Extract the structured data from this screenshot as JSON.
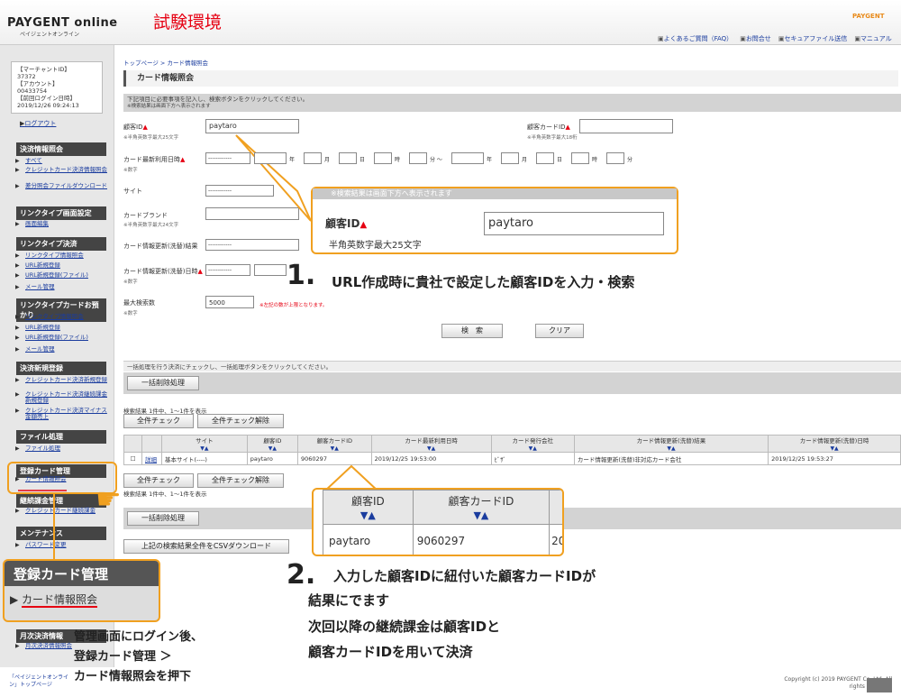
{
  "header": {
    "logo": "PAYGENT online",
    "logo_sub": "ペイジェントオンライン",
    "env_title": "試験環境",
    "brand": "PAYGENT",
    "links": [
      "よくあるご質問（FAQ）",
      "お問合せ",
      "セキュアファイル送信",
      "マニュアル"
    ]
  },
  "sidebar": {
    "merchant_box": [
      "【マーチャントID】",
      "37372",
      "【アカウント】",
      "00433754",
      "【前回ログイン日時】",
      "2019/12/26 09:24:13"
    ],
    "logout": "ログアウト",
    "sections": [
      {
        "title": "決済情報照会",
        "items": [
          "すべて",
          "クレジットカード決済情報照会",
          "差分照会ファイルダウンロード"
        ]
      },
      {
        "title": "リンクタイプ画面設定",
        "items": [
          "画面編集"
        ]
      },
      {
        "title": "リンクタイプ決済",
        "items": [
          "リンクタイプ情報照会",
          "URL新規登録",
          "URL新規登録(ファイル)",
          "メール管理"
        ]
      },
      {
        "title": "リンクタイプカードお預かり",
        "items": [
          "リンクタイプ情報照会",
          "URL新規登録",
          "URL新規登録(ファイル)",
          "メール管理"
        ]
      },
      {
        "title": "決済新規登録",
        "items": [
          "クレジットカード決済新規登録",
          "クレジットカード決済継続課金新規登録",
          "クレジットカード決済マイナス金額売上"
        ]
      },
      {
        "title": "ファイル処理",
        "items": [
          "ファイル処理"
        ]
      },
      {
        "title": "登録カード管理",
        "items": [
          "カード情報照会"
        ]
      },
      {
        "title": "継続課金管理",
        "items": [
          "クレジットカード継続課金"
        ]
      },
      {
        "title": "メンテナンス",
        "items": [
          "パスワード変更"
        ]
      },
      {
        "title": "月次決済情報",
        "items": [
          "月次決済情報照会"
        ]
      }
    ],
    "footer": "「ペイジェントオンライン」トップページ"
  },
  "main": {
    "breadcrumb": "トップページ > カード情報照会",
    "title": "カード情報照会",
    "instructions": "下記項目に必要事項を記入し、検索ボタンをクリックしてください。",
    "instructions2": "※検索結果は画面下方へ表示されます",
    "fields": {
      "customer_id_label": "顧客ID",
      "customer_id_value": "paytaro",
      "customer_id_note": "※半角英数字最大25文字",
      "customer_card_id_label": "顧客カードID",
      "customer_card_id_note": "※半角英数字最大18桁",
      "last_used_label": "カード最新利用日時",
      "last_used_note": "※数字",
      "site_label": "サイト",
      "brand_label": "カードブランド",
      "brand_note": "※半角英数字最大24文字",
      "update_result_label": "カード情報更新(洗替)結果",
      "update_date_label": "カード情報更新(洗替)日時",
      "update_date_note": "※数字",
      "max_count_label": "最大検索数",
      "max_count_value": "5000",
      "max_count_note": "※数字",
      "max_count_warning": "※左記の数が上限となります。",
      "select_default": "------------",
      "date_units": [
        "年",
        "月",
        "日",
        "時",
        "分 〜",
        "年",
        "月",
        "日",
        "時",
        "分"
      ]
    },
    "search_button": "検　索",
    "clear_button": "クリア",
    "bulk_instructions": "一括処理を行う決済にチェックし、一括処理ボタンをクリックしてください。",
    "bulk_delete_button": "一括削除処理",
    "result_count": "検索結果 1件中、1〜1件を表示",
    "check_all": "全件チェック",
    "uncheck_all": "全件チェック解除",
    "table": {
      "headers": [
        "",
        "",
        "サイト",
        "顧客ID",
        "顧客カードID",
        "カード最新利用日時",
        "カード発行会社",
        "カード情報更新(洗替)結果",
        "カード情報更新(洗替)日時"
      ],
      "row": [
        "",
        "詳細",
        "基本サイト(----)",
        "paytaro",
        "9060297",
        "2019/12/25 19:53:00",
        "ﾋﾞｻﾞ",
        "カード情報更新(洗替)非対応カード会社",
        "2019/12/25 19:53:27"
      ]
    },
    "csv_button": "上記の検索結果全件をCSVダウンロード"
  },
  "callouts": {
    "zoom1_header": "※検索結果は画面下方へ表示されます",
    "zoom1_label": "顧客ID",
    "zoom1_value": "paytaro",
    "zoom1_note": "半角英数字最大25文字",
    "zoom2_headers": [
      "顧客ID",
      "顧客カードID"
    ],
    "zoom2_values": [
      "paytaro",
      "9060297",
      "20"
    ],
    "zoom3_title": "登録カード管理",
    "zoom3_item": "カード情報照会",
    "step1_num": "1.",
    "step1_text": "URL作成時に貴社で設定した顧客IDを入力・検索",
    "step2_num": "2.",
    "step2_text1": "入力した顧客IDに紐付いた顧客カードIDが",
    "step2_text2": "結果にでます",
    "step2_text3": "次回以降の継続課金は顧客IDと",
    "step2_text4": "顧客カードIDを用いて決済",
    "step0_text1": "管理画面にログイン後、",
    "step0_text2": "登録カード管理 ＞",
    "step0_text3": "カード情報照会を押下"
  },
  "copyright": "Copyright (c) 2019 PAYGENT Co.,Ltd. All rights reserved."
}
